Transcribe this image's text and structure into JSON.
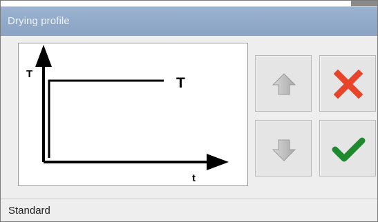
{
  "window": {
    "title": "Drying profile"
  },
  "profile_graph": {
    "y_axis_label": "T",
    "x_axis_label": "t",
    "level_label": "T"
  },
  "buttons": {
    "up_icon": "arrow-up-icon",
    "down_icon": "arrow-down-icon",
    "cancel_icon": "red-x-icon",
    "confirm_icon": "green-checkmark-icon"
  },
  "status": {
    "selected_profile": "Standard"
  },
  "colors": {
    "titlebar": "#8fa8c8",
    "cancel": "#e8442a",
    "confirm": "#1e8a2e",
    "arrow_gray": "#b8b8b8"
  }
}
